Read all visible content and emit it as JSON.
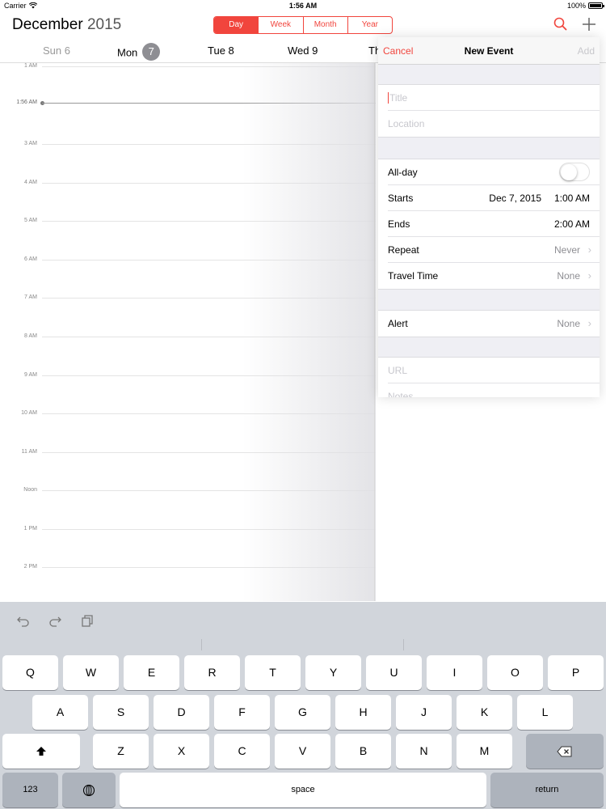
{
  "status_bar": {
    "carrier": "Carrier",
    "time": "1:56 AM",
    "battery_label": "100%",
    "battery_level": 1.0
  },
  "header": {
    "month": "December",
    "year": "2015",
    "view_tabs": [
      {
        "label": "Day",
        "active": true
      },
      {
        "label": "Week",
        "active": false
      },
      {
        "label": "Month",
        "active": false
      },
      {
        "label": "Year",
        "active": false
      }
    ],
    "icons": [
      "search-icon",
      "plus-icon"
    ],
    "accent_color": "#f1453d"
  },
  "days": [
    {
      "label": "Sun 6",
      "muted": true
    },
    {
      "label": "Mon",
      "number": "7",
      "selected": true
    },
    {
      "label": "Tue 8"
    },
    {
      "label": "Wed 9"
    },
    {
      "label": "Th"
    }
  ],
  "time_grid": {
    "hours": [
      "1 AM",
      "2 AM",
      "3 AM",
      "4 AM",
      "5 AM",
      "6 AM",
      "7 AM",
      "8 AM",
      "9 AM",
      "10 AM",
      "11 AM",
      "Noon",
      "1 PM",
      "2 PM"
    ],
    "current_time_label": "1:56 AM"
  },
  "new_event": {
    "cancel": "Cancel",
    "title": "New Event",
    "add": "Add",
    "title_placeholder": "Title",
    "location_placeholder": "Location",
    "all_day_label": "All-day",
    "all_day_on": false,
    "starts_label": "Starts",
    "starts_date": "Dec 7, 2015",
    "starts_time": "1:00 AM",
    "ends_label": "Ends",
    "ends_time": "2:00 AM",
    "repeat_label": "Repeat",
    "repeat_value": "Never",
    "travel_label": "Travel Time",
    "travel_value": "None",
    "alert_label": "Alert",
    "alert_value": "None",
    "url_placeholder": "URL",
    "notes_placeholder": "Notes"
  },
  "keyboard": {
    "toolbar": [
      "undo-icon",
      "redo-icon",
      "paste-icon"
    ],
    "row1": [
      "Q",
      "W",
      "E",
      "R",
      "T",
      "Y",
      "U",
      "I",
      "O",
      "P"
    ],
    "row2": [
      "A",
      "S",
      "D",
      "F",
      "G",
      "H",
      "J",
      "K",
      "L"
    ],
    "row3": [
      "Z",
      "X",
      "C",
      "V",
      "B",
      "N",
      "M"
    ],
    "numbers": "123",
    "space": "space",
    "return": "return"
  }
}
